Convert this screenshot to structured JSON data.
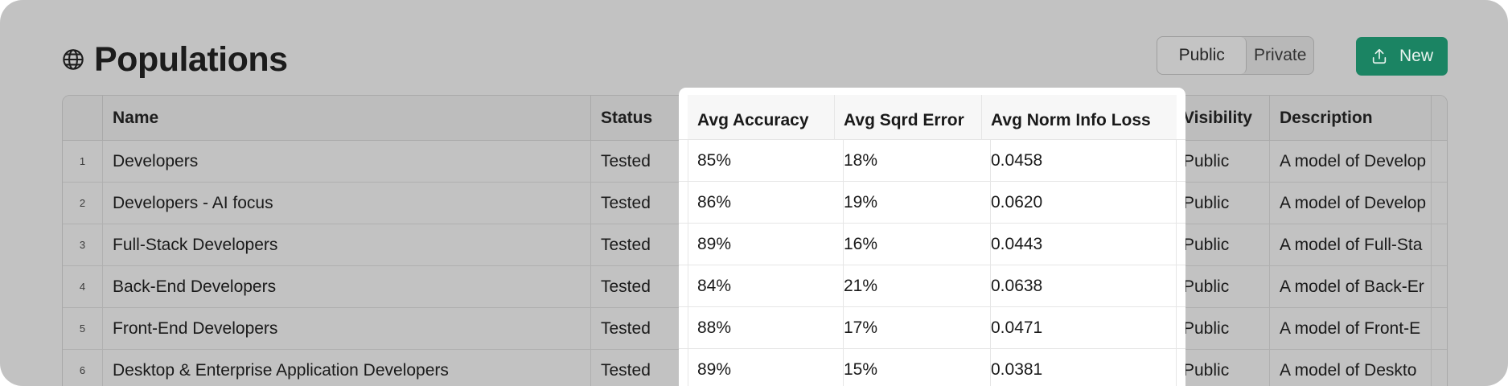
{
  "header": {
    "title": "Populations",
    "icon": "globe-icon"
  },
  "visibility_toggle": {
    "options": [
      "Public",
      "Private"
    ],
    "selected": "Public"
  },
  "new_button": {
    "label": "New",
    "icon": "upload-icon"
  },
  "colors": {
    "accent": "#1b8463",
    "overlay_bg": "#c2c2c2",
    "highlight_bg": "#ffffff"
  },
  "table": {
    "columns": [
      "Name",
      "Status",
      "Avg Accuracy",
      "Avg Sqrd Error",
      "Avg Norm Info Loss",
      "Visibility",
      "Description"
    ],
    "highlighted_columns": [
      "Avg Accuracy",
      "Avg Sqrd Error",
      "Avg Norm Info Loss"
    ],
    "rows": [
      {
        "num": "1",
        "name": "Developers",
        "status": "Tested",
        "acc": "85%",
        "sqe": "18%",
        "nil": "0.0458",
        "vis": "Public",
        "desc": "A model of Develop"
      },
      {
        "num": "2",
        "name": "Developers - AI focus",
        "status": "Tested",
        "acc": "86%",
        "sqe": "19%",
        "nil": "0.0620",
        "vis": "Public",
        "desc": "A model of Develop"
      },
      {
        "num": "3",
        "name": "Full-Stack Developers",
        "status": "Tested",
        "acc": "89%",
        "sqe": "16%",
        "nil": "0.0443",
        "vis": "Public",
        "desc": "A model of Full-Sta"
      },
      {
        "num": "4",
        "name": "Back-End Developers",
        "status": "Tested",
        "acc": "84%",
        "sqe": "21%",
        "nil": "0.0638",
        "vis": "Public",
        "desc": "A model of Back-Er"
      },
      {
        "num": "5",
        "name": "Front-End Developers",
        "status": "Tested",
        "acc": "88%",
        "sqe": "17%",
        "nil": "0.0471",
        "vis": "Public",
        "desc": "A model of Front-E"
      },
      {
        "num": "6",
        "name": "Desktop & Enterprise Application Developers",
        "status": "Tested",
        "acc": "89%",
        "sqe": "15%",
        "nil": "0.0381",
        "vis": "Public",
        "desc": "A model of Deskto"
      }
    ]
  }
}
